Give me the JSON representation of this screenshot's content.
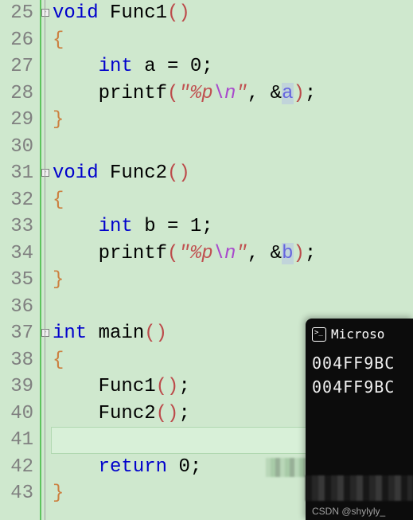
{
  "line_numbers": [
    "25",
    "26",
    "27",
    "28",
    "29",
    "30",
    "31",
    "32",
    "33",
    "34",
    "35",
    "36",
    "37",
    "38",
    "39",
    "40",
    "41",
    "42",
    "43"
  ],
  "code": {
    "l25": {
      "kw": "void",
      "sp": " ",
      "fn": "Func1"
    },
    "l26": {
      "brace": "{"
    },
    "l27": {
      "type": "int",
      "sp": " ",
      "var": "a",
      "eq": " = ",
      "val": "0",
      "semi": ";"
    },
    "l28": {
      "fn": "printf",
      "str1": "\"%p",
      "esc": "\\n",
      "str2": "\"",
      "arg": "a"
    },
    "l29": {
      "brace": "}"
    },
    "l31": {
      "kw": "void",
      "sp": " ",
      "fn": "Func2"
    },
    "l32": {
      "brace": "{"
    },
    "l33": {
      "type": "int",
      "sp": " ",
      "var": "b",
      "eq": " = ",
      "val": "1",
      "semi": ";"
    },
    "l34": {
      "fn": "printf",
      "str1": "\"%p",
      "esc": "\\n",
      "str2": "\"",
      "arg": "b"
    },
    "l35": {
      "brace": "}"
    },
    "l37": {
      "type": "int",
      "sp": " ",
      "fn": "main"
    },
    "l38": {
      "brace": "{"
    },
    "l39": {
      "fn": "Func1"
    },
    "l40": {
      "fn": "Func2"
    },
    "l42": {
      "kw": "return",
      "sp": " ",
      "val": "0",
      "semi": ";"
    },
    "l43": {
      "brace": "}"
    }
  },
  "terminal": {
    "title": "Microso",
    "out1": "004FF9BC",
    "out2": "004FF9BC"
  },
  "watermark": "CSDN @shylyly_"
}
